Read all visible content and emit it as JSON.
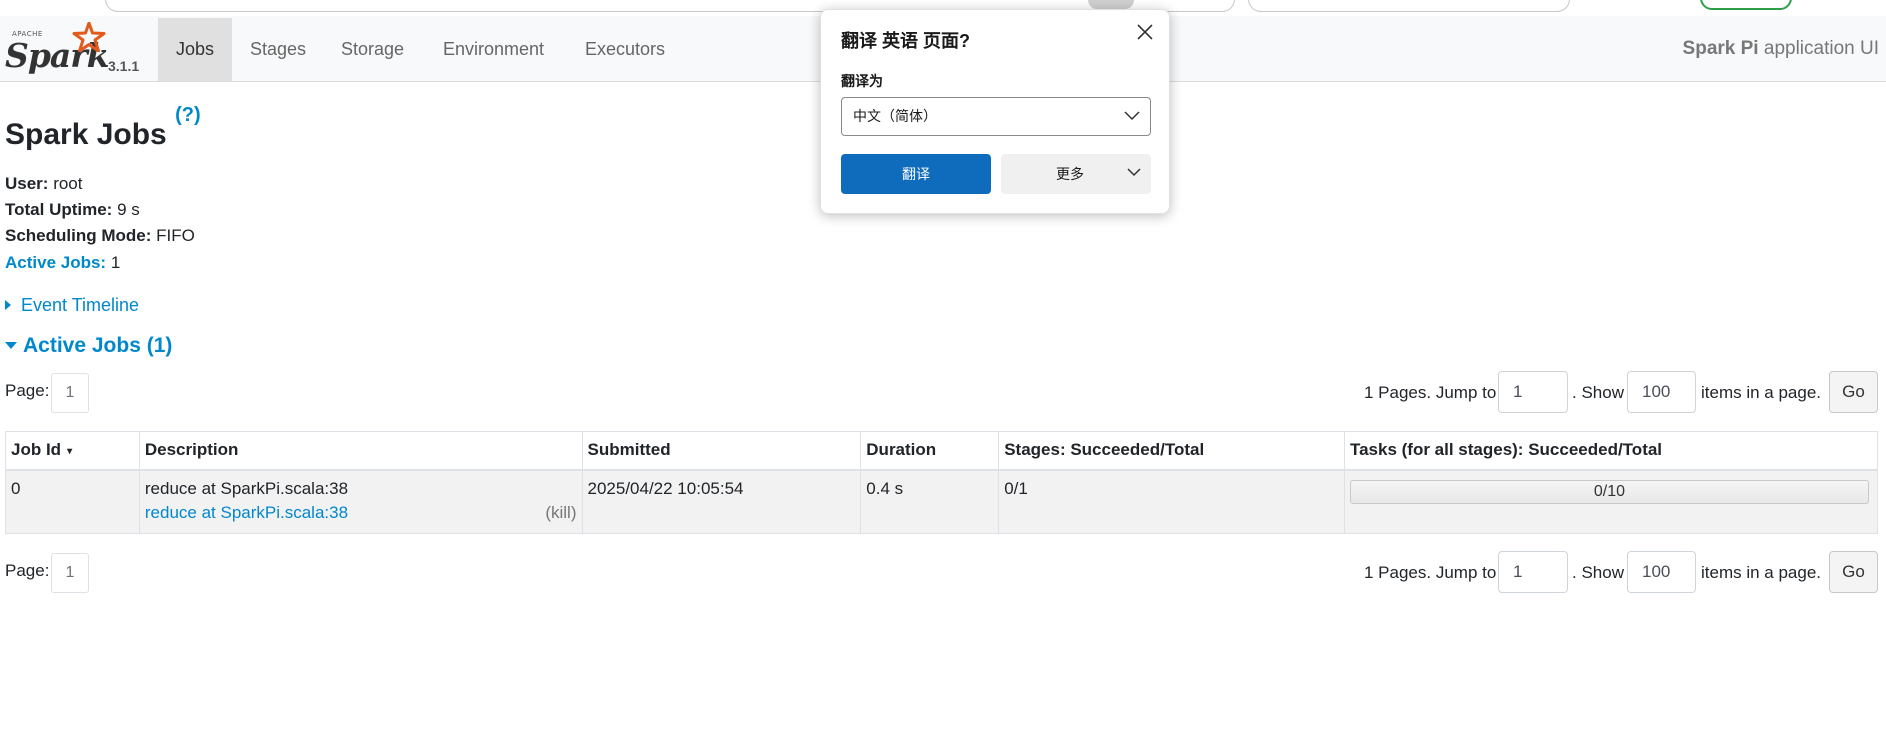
{
  "browser": {
    "icons": [
      "reader-icon",
      "favorites-icon",
      "collections-icon"
    ]
  },
  "navbar": {
    "brand_apache": "APACHE",
    "brand_name": "Spark",
    "version": "3.1.1",
    "tabs": [
      {
        "label": "Jobs",
        "active": true
      },
      {
        "label": "Stages",
        "active": false
      },
      {
        "label": "Storage",
        "active": false
      },
      {
        "label": "Environment",
        "active": false
      },
      {
        "label": "Executors",
        "active": false
      }
    ],
    "app_name_bold": "Spark Pi",
    "app_name_suffix": " application UI"
  },
  "page": {
    "title": "Spark Jobs",
    "help": "(?)",
    "user_label": "User:",
    "user_value": " root",
    "uptime_label": "Total Uptime:",
    "uptime_value": " 9 s",
    "sched_label": "Scheduling Mode:",
    "sched_value": " FIFO",
    "active_label": "Active Jobs:",
    "active_value": " 1",
    "event_timeline": "Event Timeline",
    "active_jobs_header": "Active Jobs (1)"
  },
  "pager": {
    "page_label": "Page:",
    "page_number": "1",
    "pages_text": "1 Pages. Jump to",
    "jump_value": "1",
    "show_text": ". Show",
    "show_value": "100",
    "items_text": "items in a page.",
    "go_label": "Go"
  },
  "table": {
    "columns": [
      "Job Id",
      "Description",
      "Submitted",
      "Duration",
      "Stages: Succeeded/Total",
      "Tasks (for all stages): Succeeded/Total"
    ],
    "sort_indicator": "▾",
    "rows": [
      {
        "job_id": "0",
        "description": "reduce at SparkPi.scala:38",
        "description_link": "reduce at SparkPi.scala:38",
        "kill": "(kill)",
        "submitted": "2025/04/22 10:05:54",
        "duration": "0.4 s",
        "stages": "0/1",
        "tasks": "0/10",
        "tasks_progress": 0
      }
    ]
  },
  "translate_popup": {
    "title": "翻译 英语 页面?",
    "translate_to_label": "翻译为",
    "selected_language": "中文（简体）",
    "translate_button": "翻译",
    "more_button": "更多"
  },
  "colors": {
    "link": "#0088cc",
    "navbar_bg": "#f8f9fa",
    "primary_button": "#0f6cbd",
    "brand_star": "#e25a1c"
  }
}
